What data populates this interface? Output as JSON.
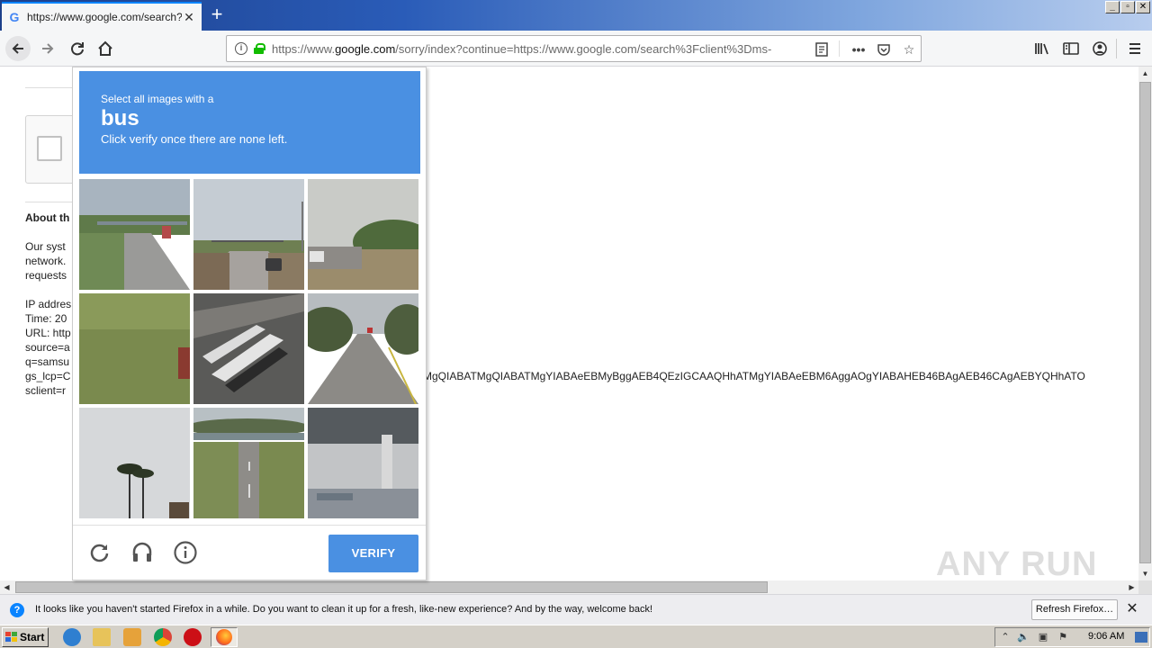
{
  "browser": {
    "tab_title": "https://www.google.com/search?c",
    "url_prefix": "https://www.",
    "url_domain": "google.com",
    "url_rest": "/sorry/index?continue=https://www.google.com/search%3Fclient%3Dms-",
    "new_tab_symbol": "+"
  },
  "background_page": {
    "about_title": "About th",
    "lines": [
      "Our syst",
      "network.",
      "requests",
      "",
      "IP addres",
      "Time: 20",
      "URL: http",
      "source=a",
      "q=samsu",
      "gs_lcp=C",
      "sclient=r"
    ],
    "long_url_fragment": "MgQIABATMgQIABATMgYIABAeEBMyBggAEB4QEzIGCAAQHhATMgYIABAeEBM6AggAOgYIABAHEB46BAgAEB46CAgAEBYQHhATO"
  },
  "captcha": {
    "lead": "Select all images with a",
    "target": "bus",
    "sub": "Click verify once there are none left.",
    "verify_label": "VERIFY",
    "accent": "#4a90e2"
  },
  "watermark": "ANY RUN",
  "notification": {
    "message": "It looks like you haven't started Firefox in a while. Do you want to clean it up for a fresh, like-new experience? And by the way, welcome back!",
    "button_label": "Refresh Firefox…"
  },
  "taskbar": {
    "start_label": "Start",
    "clock": "9:06 AM"
  }
}
